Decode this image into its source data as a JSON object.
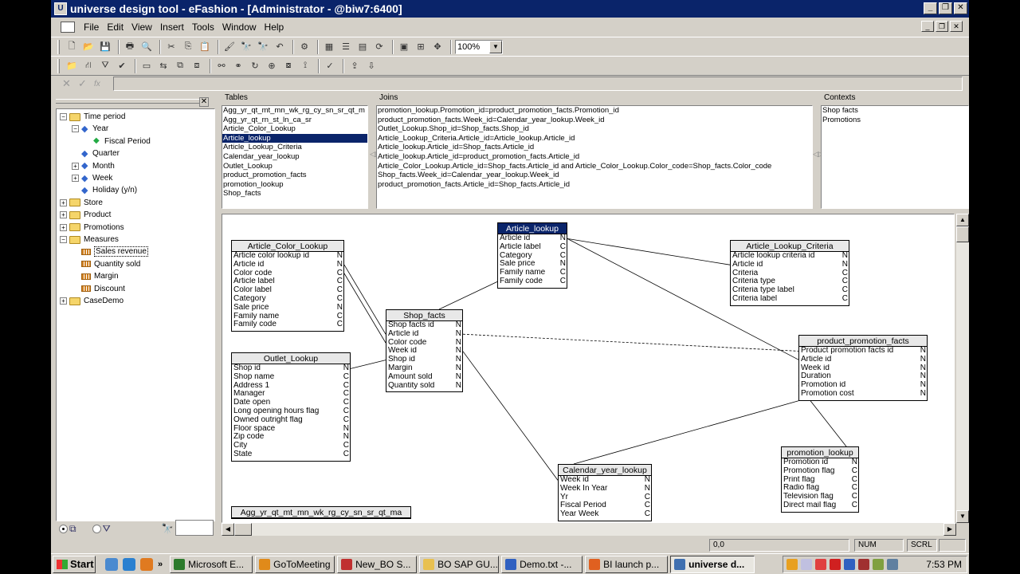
{
  "window": {
    "title": "universe design tool - eFashion - [Administrator - @biw7:6400]"
  },
  "menu": [
    "File",
    "Edit",
    "View",
    "Insert",
    "Tools",
    "Window",
    "Help"
  ],
  "toolbar": {
    "zoom": "100%"
  },
  "tree": {
    "items": [
      {
        "label": "Time period",
        "type": "folder",
        "level": 0,
        "toggle": "−"
      },
      {
        "label": "Year",
        "type": "dimension",
        "level": 1,
        "toggle": "−"
      },
      {
        "label": "Fiscal Period",
        "type": "detail",
        "level": 2,
        "toggle": ""
      },
      {
        "label": "Quarter",
        "type": "dimension",
        "level": 1,
        "toggle": ""
      },
      {
        "label": "Month",
        "type": "dimension",
        "level": 1,
        "toggle": "+"
      },
      {
        "label": "Week",
        "type": "dimension",
        "level": 1,
        "toggle": "+"
      },
      {
        "label": "Holiday (y/n)",
        "type": "dimension",
        "level": 1,
        "toggle": ""
      },
      {
        "label": "Store",
        "type": "folder",
        "level": 0,
        "toggle": "+"
      },
      {
        "label": "Product",
        "type": "folder",
        "level": 0,
        "toggle": "+"
      },
      {
        "label": "Promotions",
        "type": "folder",
        "level": 0,
        "toggle": "+"
      },
      {
        "label": "Measures",
        "type": "folder",
        "level": 0,
        "toggle": "−"
      },
      {
        "label": "Sales revenue",
        "type": "measure",
        "level": 1,
        "toggle": "",
        "selected": true
      },
      {
        "label": "Quantity sold",
        "type": "measure",
        "level": 1,
        "toggle": ""
      },
      {
        "label": "Margin",
        "type": "measure",
        "level": 1,
        "toggle": ""
      },
      {
        "label": "Discount",
        "type": "measure",
        "level": 1,
        "toggle": ""
      },
      {
        "label": "CaseDemo",
        "type": "folder",
        "level": 0,
        "toggle": "+"
      }
    ]
  },
  "panes": {
    "tables_label": "Tables",
    "joins_label": "Joins",
    "contexts_label": "Contexts",
    "tables": [
      "Agg_yr_qt_mt_mn_wk_rg_cy_sn_sr_qt_m",
      "Agg_yr_qt_rn_st_ln_ca_sr",
      "Article_Color_Lookup",
      "Article_lookup",
      "Article_Lookup_Criteria",
      "Calendar_year_lookup",
      "Outlet_Lookup",
      "product_promotion_facts",
      "promotion_lookup",
      "Shop_facts"
    ],
    "selected_table_index": 3,
    "joins": [
      "promotion_lookup.Promotion_id=product_promotion_facts.Promotion_id",
      "product_promotion_facts.Week_id=Calendar_year_lookup.Week_id",
      "Outlet_Lookup.Shop_id=Shop_facts.Shop_id",
      "Article_Lookup_Criteria.Article_id=Article_lookup.Article_id",
      "Article_lookup.Article_id=Shop_facts.Article_id",
      "Article_lookup.Article_id=product_promotion_facts.Article_id",
      "Article_Color_Lookup.Article_id=Shop_facts.Article_id and Article_Color_Lookup.Color_code=Shop_facts.Color_code",
      "Shop_facts.Week_id=Calendar_year_lookup.Week_id",
      "product_promotion_facts.Article_id=Shop_facts.Article_id"
    ],
    "contexts": [
      "Shop facts",
      "Promotions"
    ]
  },
  "schema": {
    "tables": [
      {
        "id": "acl",
        "name": "Article_Color_Lookup",
        "cols": [
          [
            "Article color lookup id",
            "N"
          ],
          [
            "Article id",
            "N"
          ],
          [
            "Color code",
            "C"
          ],
          [
            "Article label",
            "C"
          ],
          [
            "Color label",
            "C"
          ],
          [
            "Category",
            "C"
          ],
          [
            "Sale price",
            "N"
          ],
          [
            "Family name",
            "C"
          ],
          [
            "Family code",
            "C"
          ]
        ]
      },
      {
        "id": "al",
        "name": "Article_lookup",
        "selected": true,
        "cols": [
          [
            "Article id",
            "N"
          ],
          [
            "Article label",
            "C"
          ],
          [
            "Category",
            "C"
          ],
          [
            "Sale price",
            "N"
          ],
          [
            "Family name",
            "C"
          ],
          [
            "Family code",
            "C"
          ]
        ]
      },
      {
        "id": "alc",
        "name": "Article_Lookup_Criteria",
        "cols": [
          [
            "Article lookup criteria id",
            "N"
          ],
          [
            "Article id",
            "N"
          ],
          [
            "Criteria",
            "C"
          ],
          [
            "Criteria type",
            "C"
          ],
          [
            "Criteria type label",
            "C"
          ],
          [
            "Criteria label",
            "C"
          ]
        ]
      },
      {
        "id": "sf",
        "name": "Shop_facts",
        "cols": [
          [
            "Shop facts id",
            "N"
          ],
          [
            "Article id",
            "N"
          ],
          [
            "Color code",
            "N"
          ],
          [
            "Week id",
            "N"
          ],
          [
            "Shop id",
            "N"
          ],
          [
            "Margin",
            "N"
          ],
          [
            "Amount sold",
            "N"
          ],
          [
            "Quantity sold",
            "N"
          ]
        ]
      },
      {
        "id": "ol",
        "name": "Outlet_Lookup",
        "cols": [
          [
            "Shop id",
            "N"
          ],
          [
            "Shop name",
            "C"
          ],
          [
            "Address 1",
            "C"
          ],
          [
            "Manager",
            "C"
          ],
          [
            "Date open",
            "C"
          ],
          [
            "Long opening hours flag",
            "C"
          ],
          [
            "Owned outright flag",
            "C"
          ],
          [
            "Floor space",
            "N"
          ],
          [
            "Zip code",
            "N"
          ],
          [
            "City",
            "C"
          ],
          [
            "State",
            "C"
          ]
        ]
      },
      {
        "id": "ppf",
        "name": "product_promotion_facts",
        "cols": [
          [
            "Product promotion facts id",
            "N"
          ],
          [
            "Article id",
            "N"
          ],
          [
            "Week id",
            "N"
          ],
          [
            "Duration",
            "N"
          ],
          [
            "Promotion id",
            "N"
          ],
          [
            "Promotion cost",
            "N"
          ]
        ]
      },
      {
        "id": "cyl",
        "name": "Calendar_year_lookup",
        "cols": [
          [
            "Week id",
            "N"
          ],
          [
            "Week In Year",
            "N"
          ],
          [
            "Yr",
            "C"
          ],
          [
            "Fiscal Period",
            "C"
          ],
          [
            "Year Week",
            "C"
          ]
        ]
      },
      {
        "id": "pl",
        "name": "promotion_lookup",
        "cols": [
          [
            "Promotion id",
            "N"
          ],
          [
            "Promotion flag",
            "C"
          ],
          [
            "Print flag",
            "C"
          ],
          [
            "Radio flag",
            "C"
          ],
          [
            "Television flag",
            "C"
          ],
          [
            "Direct mail flag",
            "C"
          ]
        ]
      },
      {
        "id": "agg",
        "name": "Agg_yr_qt_mt_mn_wk_rg_cy_sn_sr_qt_ma",
        "cols": []
      }
    ]
  },
  "status": {
    "coords": "0,0",
    "num": "NUM",
    "scrl": "SCRL"
  },
  "taskbar": {
    "start": "Start",
    "tasks": [
      {
        "label": "Microsoft E...",
        "color": "#2b7a2b"
      },
      {
        "label": "GoToMeeting",
        "color": "#e08a1a"
      },
      {
        "label": "New_BO S...",
        "color": "#c03030"
      },
      {
        "label": "BO SAP GU...",
        "color": "#e8c050"
      },
      {
        "label": "Demo.txt -...",
        "color": "#3060c0"
      },
      {
        "label": "BI launch p...",
        "color": "#e06020"
      },
      {
        "label": "universe d...",
        "color": "#4070b0",
        "active": true
      }
    ],
    "clock": "7:53 PM"
  }
}
